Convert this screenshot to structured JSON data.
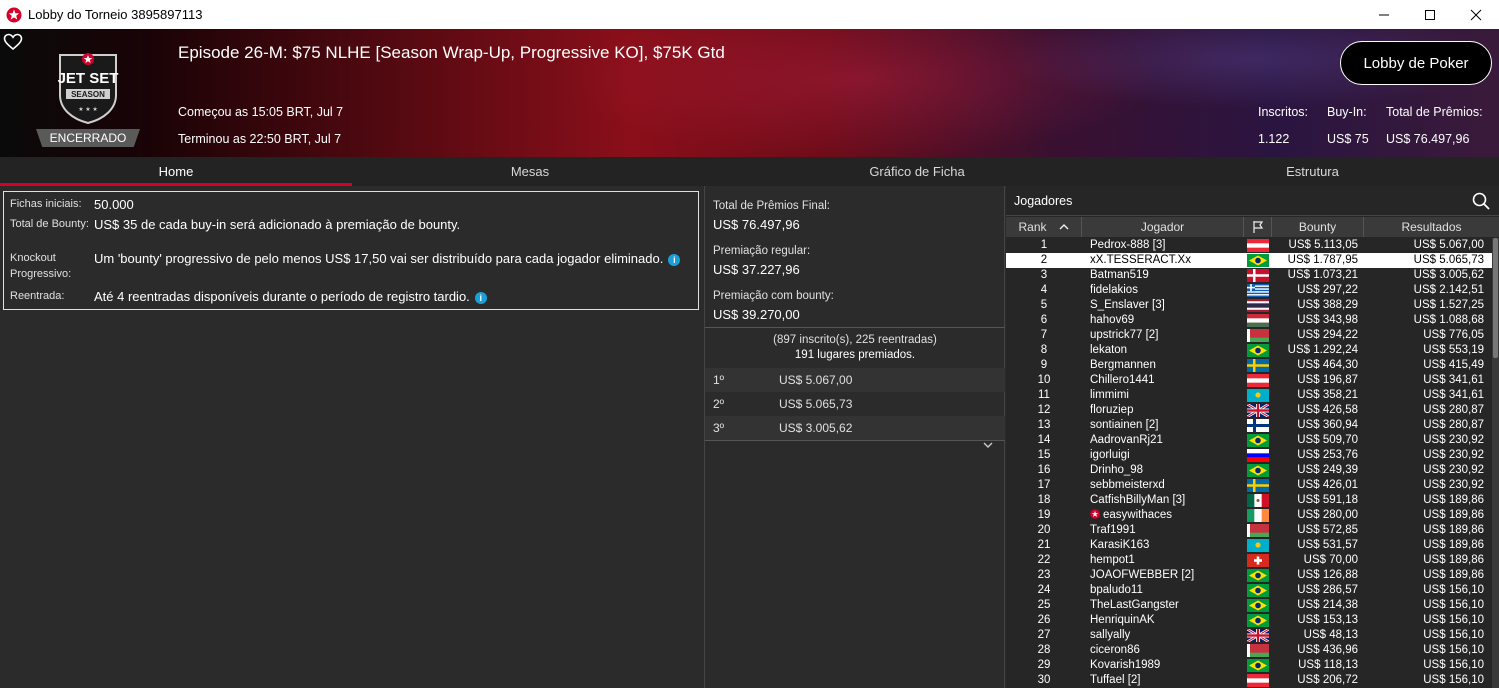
{
  "window": {
    "title": "Lobby do Torneio 3895897113",
    "minimize_icon": "minimize-icon",
    "maximize_icon": "maximize-icon",
    "close_icon": "close-icon"
  },
  "header": {
    "status": "ENCERRADO",
    "tournament_title": "Episode 26-M: $75 NLHE [Season Wrap-Up, Progressive KO], $75K Gtd",
    "started": "Começou as 15:05 BRT, Jul 7",
    "ended": "Terminou as 22:50 BRT, Jul 7",
    "lobby_button": "Lobby de Poker",
    "stats": {
      "entrants_label": "Inscritos:",
      "entrants_value": "1.122",
      "buyin_label": "Buy-In:",
      "buyin_value": "US$ 75",
      "prize_label": "Total de Prêmios:",
      "prize_value": "US$ 76.497,96"
    }
  },
  "tabs": [
    {
      "label": "Home",
      "active": true
    },
    {
      "label": "Mesas",
      "active": false
    },
    {
      "label": "Gráfico de Ficha",
      "active": false
    },
    {
      "label": "Estrutura",
      "active": false
    }
  ],
  "info": {
    "starting_chips_label": "Fichas iniciais:",
    "starting_chips_value": "50.000",
    "total_bounty_label": "Total de Bounty:",
    "total_bounty_value": "US$ 35 de cada buy-in será adicionado à premiação de bounty.",
    "pko_label": "Knockout Progressivo:",
    "pko_value": "Um 'bounty' progressivo de pelo menos US$ 17,50 vai ser distribuído para cada jogador eliminado.",
    "reentry_label": "Reentrada:",
    "reentry_value": "Até 4 reentradas disponíveis durante o período de registro tardio."
  },
  "prizes": {
    "final_label": "Total de Prêmios Final:",
    "final_value": "US$ 76.497,96",
    "regular_label": "Premiação regular:",
    "regular_value": "US$ 37.227,96",
    "bounty_label": "Premiação com bounty:",
    "bounty_value": "US$ 39.270,00",
    "entries_line": "(897 inscrito(s), 225 reentradas)",
    "paid_line": "191 lugares premiados.",
    "places": [
      {
        "pos": "1º",
        "amount": "US$ 5.067,00"
      },
      {
        "pos": "2º",
        "amount": "US$ 5.065,73"
      },
      {
        "pos": "3º",
        "amount": "US$ 3.005,62"
      }
    ]
  },
  "players": {
    "header": "Jogadores",
    "columns": {
      "rank": "Rank",
      "player": "Jogador",
      "bounty": "Bounty",
      "results": "Resultados"
    },
    "rows": [
      {
        "rank": "1",
        "name": "Pedrox-888 [3]",
        "flag": "AT",
        "bounty": "US$ 5.113,05",
        "result": "US$ 5.067,00"
      },
      {
        "rank": "2",
        "name": "xX.TESSERACT.Xx",
        "flag": "BR",
        "bounty": "US$ 1.787,95",
        "result": "US$ 5.065,73",
        "selected": true
      },
      {
        "rank": "3",
        "name": "Batman519",
        "flag": "DK",
        "bounty": "US$ 1.073,21",
        "result": "US$ 3.005,62"
      },
      {
        "rank": "4",
        "name": "fidelakios",
        "flag": "GR",
        "bounty": "US$ 297,22",
        "result": "US$ 2.142,51"
      },
      {
        "rank": "5",
        "name": "S_Enslaver [3]",
        "flag": "TH",
        "bounty": "US$ 388,29",
        "result": "US$ 1.527,25"
      },
      {
        "rank": "6",
        "name": "hahov69",
        "flag": "HU",
        "bounty": "US$ 343,98",
        "result": "US$ 1.088,68"
      },
      {
        "rank": "7",
        "name": "upstrick77 [2]",
        "flag": "BY",
        "bounty": "US$ 294,22",
        "result": "US$ 776,05"
      },
      {
        "rank": "8",
        "name": "lekaton",
        "flag": "BR",
        "bounty": "US$ 1.292,24",
        "result": "US$ 553,19"
      },
      {
        "rank": "9",
        "name": "Bergmannen",
        "flag": "SE",
        "bounty": "US$ 464,30",
        "result": "US$ 415,49"
      },
      {
        "rank": "10",
        "name": "Chillero1441",
        "flag": "AT",
        "bounty": "US$ 196,87",
        "result": "US$ 341,61"
      },
      {
        "rank": "11",
        "name": "limmimi",
        "flag": "KZ",
        "bounty": "US$ 358,21",
        "result": "US$ 341,61"
      },
      {
        "rank": "12",
        "name": "floruziep",
        "flag": "GB",
        "bounty": "US$ 426,58",
        "result": "US$ 280,87"
      },
      {
        "rank": "13",
        "name": "sontiainen [2]",
        "flag": "FI",
        "bounty": "US$ 360,94",
        "result": "US$ 280,87"
      },
      {
        "rank": "14",
        "name": "AadrovanRj21",
        "flag": "BR",
        "bounty": "US$ 509,70",
        "result": "US$ 230,92"
      },
      {
        "rank": "15",
        "name": "igorluigi",
        "flag": "SI",
        "bounty": "US$ 253,76",
        "result": "US$ 230,92"
      },
      {
        "rank": "16",
        "name": "Drinho_98",
        "flag": "BR",
        "bounty": "US$ 249,39",
        "result": "US$ 230,92"
      },
      {
        "rank": "17",
        "name": "sebbmeisterxd",
        "flag": "SE",
        "bounty": "US$ 426,01",
        "result": "US$ 230,92"
      },
      {
        "rank": "18",
        "name": "CatfishBillyMan [3]",
        "flag": "MX",
        "bounty": "US$ 591,18",
        "result": "US$ 189,86"
      },
      {
        "rank": "19",
        "name": "easywithaces",
        "flag": "IE",
        "bounty": "US$ 280,00",
        "result": "US$ 189,86",
        "pokerstars_pro": true
      },
      {
        "rank": "20",
        "name": "Traf1991",
        "flag": "BY",
        "bounty": "US$ 572,85",
        "result": "US$ 189,86"
      },
      {
        "rank": "21",
        "name": "KarasiK163",
        "flag": "KZ",
        "bounty": "US$ 531,57",
        "result": "US$ 189,86"
      },
      {
        "rank": "22",
        "name": "hempot1",
        "flag": "CH",
        "bounty": "US$ 70,00",
        "result": "US$ 189,86"
      },
      {
        "rank": "23",
        "name": "JOAOFWEBBER [2]",
        "flag": "BR",
        "bounty": "US$ 126,88",
        "result": "US$ 189,86"
      },
      {
        "rank": "24",
        "name": "bpaludo11",
        "flag": "BR",
        "bounty": "US$ 286,57",
        "result": "US$ 156,10"
      },
      {
        "rank": "25",
        "name": "TheLastGangster",
        "flag": "BR",
        "bounty": "US$ 214,38",
        "result": "US$ 156,10"
      },
      {
        "rank": "26",
        "name": "HenriquinAK",
        "flag": "BR",
        "bounty": "US$ 153,13",
        "result": "US$ 156,10"
      },
      {
        "rank": "27",
        "name": "sallyally",
        "flag": "GB",
        "bounty": "US$ 48,13",
        "result": "US$ 156,10"
      },
      {
        "rank": "28",
        "name": "ciceron86",
        "flag": "BY",
        "bounty": "US$ 436,96",
        "result": "US$ 156,10"
      },
      {
        "rank": "29",
        "name": "Kovarish1989",
        "flag": "BR",
        "bounty": "US$ 118,13",
        "result": "US$ 156,10"
      },
      {
        "rank": "30",
        "name": "Tuffael [2]",
        "flag": "AT",
        "bounty": "US$ 206,72",
        "result": "US$ 156,10"
      }
    ]
  },
  "colors": {
    "accent": "#d4002a",
    "info_icon": "#1aa0d8"
  }
}
